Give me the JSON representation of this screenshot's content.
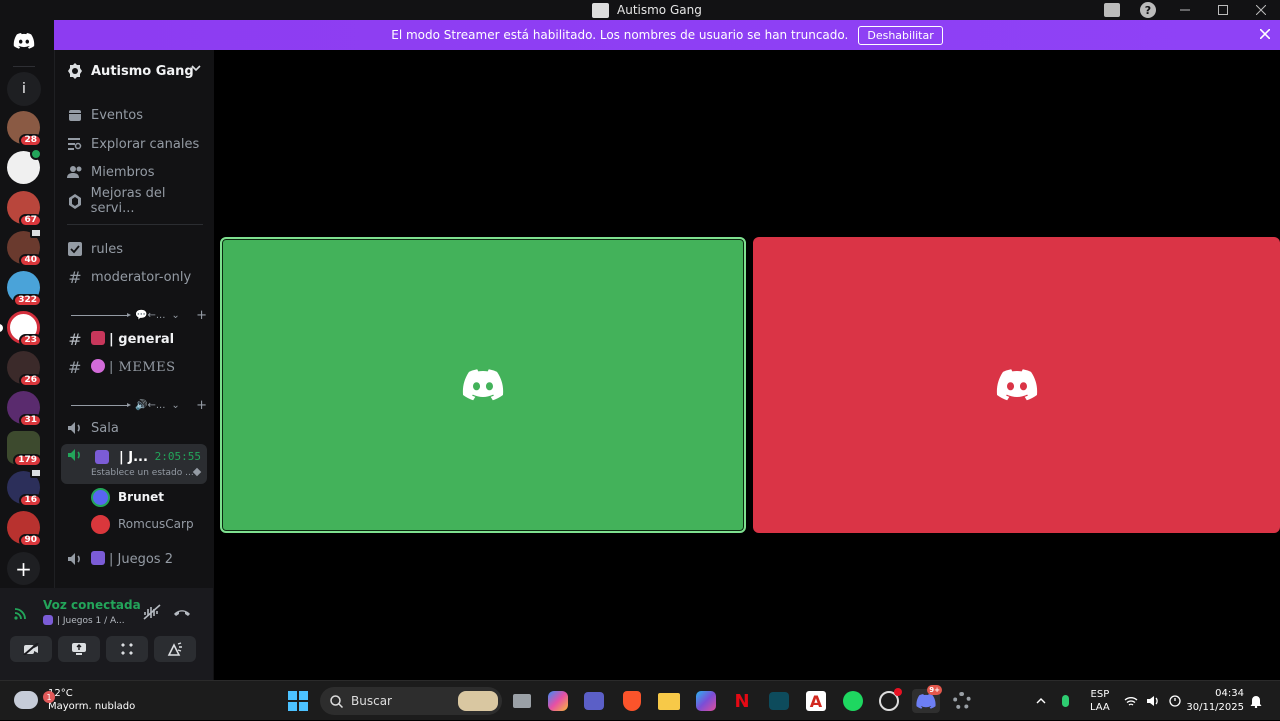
{
  "window": {
    "title": "Autismo Gang"
  },
  "streamer_banner": {
    "message": "El modo Streamer está habilitado. Los nombres de usuario se han truncado.",
    "disable_label": "Deshabilitar"
  },
  "rail": {
    "info_label": "i",
    "servers": [
      {
        "badge": "28",
        "color": "#8a5a44"
      },
      {
        "badge": "",
        "color": "#f0f0f0"
      },
      {
        "badge": "67",
        "color": "#b9463c"
      },
      {
        "badge": "40",
        "color": "#6a3a2e"
      },
      {
        "badge": "322",
        "color": "#4aa3d9"
      },
      {
        "badge": "23",
        "color": "#d32f3c"
      },
      {
        "badge": "26",
        "color": "#3b2a2a"
      },
      {
        "badge": "31",
        "color": "#5a2b6e"
      },
      {
        "badge": "179",
        "color": "#3d4a2e"
      },
      {
        "badge": "16",
        "color": "#2c2f5a"
      },
      {
        "badge": "90",
        "color": "#b8322f"
      }
    ]
  },
  "guild": {
    "name": "Autismo Gang"
  },
  "nav": {
    "events": "Eventos",
    "browse": "Explorar canales",
    "members": "Miembros",
    "boosts": "Mejoras del servi..."
  },
  "channels": {
    "rules": "rules",
    "moderator_only": "moderator-only",
    "category1": "←...",
    "general": "| general",
    "memes": "| MEMES",
    "category2": "←...",
    "sala": "Sala",
    "active_voice": "| J...",
    "active_timer": "2:05:55",
    "active_status": "Establece un estado ...",
    "juegos2": "| Juegos 2"
  },
  "voice_users": [
    {
      "name": "Brunet",
      "ring": "#23a55a"
    },
    {
      "name": "RomcusCarp",
      "ring": "#da373c"
    }
  ],
  "voice_panel": {
    "title": "Voz conectada",
    "subtitle": "| Juegos 1 / A..."
  },
  "taskbar": {
    "weather_temp": "12°C",
    "weather_desc": "Mayorm. nublado",
    "weather_badge": "1",
    "search_placeholder": "Buscar",
    "discord_badge": "9+",
    "lang1": "ESP",
    "lang2": "LAA",
    "time": "04:34",
    "date": "30/11/2025"
  },
  "colors": {
    "green_tile": "#43b25a",
    "red_tile": "#da3446",
    "accent": "#9146ff",
    "connected": "#23a55a"
  }
}
